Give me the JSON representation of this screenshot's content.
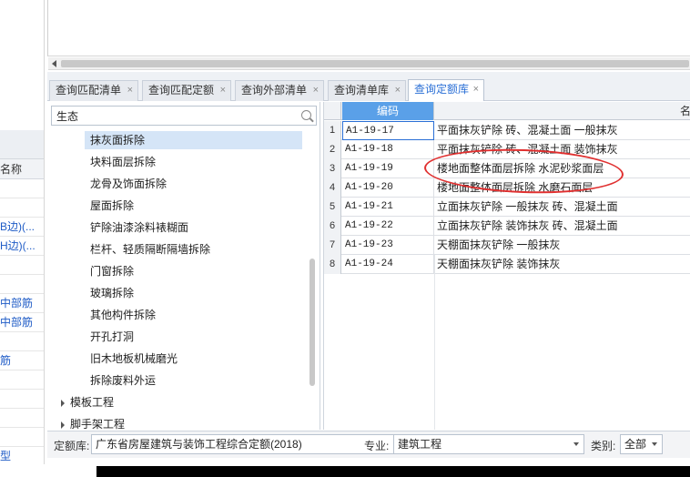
{
  "left_strip": {
    "header": "名称",
    "rows": [
      {
        "text": "",
        "blue": false
      },
      {
        "text": "",
        "blue": false
      },
      {
        "text": "B边)(...",
        "blue": true
      },
      {
        "text": "H边)(...",
        "blue": true
      },
      {
        "text": "",
        "blue": false
      },
      {
        "text": "",
        "blue": false
      },
      {
        "text": "中部筋",
        "blue": true
      },
      {
        "text": "中部筋",
        "blue": true
      },
      {
        "text": "",
        "blue": false
      },
      {
        "text": "筋",
        "blue": true
      },
      {
        "text": "",
        "blue": false
      },
      {
        "text": "",
        "blue": false
      },
      {
        "text": "",
        "blue": false
      },
      {
        "text": "",
        "blue": false
      },
      {
        "text": "型",
        "blue": true
      }
    ]
  },
  "tabs": [
    {
      "label": "查询匹配清单",
      "close": "×",
      "active": false
    },
    {
      "label": "查询匹配定额",
      "close": "×",
      "active": false
    },
    {
      "label": "查询外部清单",
      "close": "×",
      "active": false
    },
    {
      "label": "查询清单库",
      "close": "×",
      "active": false
    },
    {
      "label": "查询定额库",
      "close": "×",
      "active": true
    }
  ],
  "search": {
    "value": "生态",
    "placeholder": ""
  },
  "tree": {
    "children": [
      {
        "label": "抹灰面拆除",
        "selected": true
      },
      {
        "label": "块料面层拆除",
        "selected": false
      },
      {
        "label": "龙骨及饰面拆除",
        "selected": false
      },
      {
        "label": "屋面拆除",
        "selected": false
      },
      {
        "label": "铲除油漆涂料裱糊面",
        "selected": false
      },
      {
        "label": "栏杆、轻质隔断隔墙拆除",
        "selected": false
      },
      {
        "label": "门窗拆除",
        "selected": false
      },
      {
        "label": "玻璃拆除",
        "selected": false
      },
      {
        "label": "其他构件拆除",
        "selected": false
      },
      {
        "label": "开孔打洞",
        "selected": false
      },
      {
        "label": "旧木地板机械磨光",
        "selected": false
      },
      {
        "label": "拆除废料外运",
        "selected": false
      }
    ],
    "parents": [
      {
        "label": "模板工程"
      },
      {
        "label": "脚手架工程"
      }
    ]
  },
  "grid": {
    "columns": {
      "code": "编码",
      "name": "名"
    },
    "rows": [
      {
        "n": "1",
        "code": "A1-19-17",
        "name": "平面抹灰铲除 砖、混凝土面 一般抹灰"
      },
      {
        "n": "2",
        "code": "A1-19-18",
        "name": "平面抹灰铲除 砖、混凝土面 装饰抹灰"
      },
      {
        "n": "3",
        "code": "A1-19-19",
        "name": "楼地面整体面层拆除 水泥砂浆面层"
      },
      {
        "n": "4",
        "code": "A1-19-20",
        "name": "楼地面整体面层拆除 水磨石面层"
      },
      {
        "n": "5",
        "code": "A1-19-21",
        "name": "立面抹灰铲除 一般抹灰 砖、混凝土面"
      },
      {
        "n": "6",
        "code": "A1-19-22",
        "name": "立面抹灰铲除 装饰抹灰 砖、混凝土面"
      },
      {
        "n": "7",
        "code": "A1-19-23",
        "name": "天棚面抹灰铲除 一般抹灰"
      },
      {
        "n": "8",
        "code": "A1-19-24",
        "name": "天棚面抹灰铲除 装饰抹灰"
      }
    ],
    "selected_row": 1
  },
  "bottom": {
    "quota_label": "定额库:",
    "quota_value": "广东省房屋建筑与装饰工程综合定额(2018)",
    "specialty_label": "专业:",
    "specialty_value": "建筑工程",
    "category_label": "类别:",
    "category_value": "全部"
  },
  "colors": {
    "accent": "#2a6fd6",
    "header_blue": "#5aa0e8",
    "annotation_red": "#e03030"
  }
}
